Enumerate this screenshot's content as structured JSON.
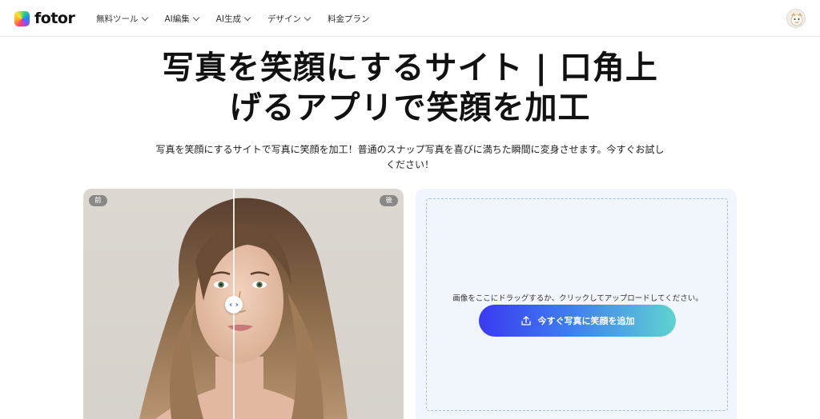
{
  "header": {
    "logo_text": "fotor",
    "nav": [
      {
        "label": "無料ツール",
        "has_dropdown": true
      },
      {
        "label": "AI編集",
        "has_dropdown": true
      },
      {
        "label": "AI生成",
        "has_dropdown": true
      },
      {
        "label": "デザイン",
        "has_dropdown": true
      },
      {
        "label": "料金プラン",
        "has_dropdown": false
      }
    ]
  },
  "hero": {
    "title_line1": "写真を笑顔にするサイト | 口角上",
    "title_line2": "げるアプリで笑顔を加工",
    "subtitle": "写真を笑顔にするサイトで写真に笑顔を加工！普通のスナップ写真を喜びに満ちた瞬間に変身させます。今すぐお試しください！"
  },
  "compare": {
    "before_label": "前",
    "after_label": "後"
  },
  "upload": {
    "hint": "画像をここにドラッグするか、クリックしてアップロードしてください。",
    "button_label": "今すぐ写真に笑顔を追加"
  },
  "colors": {
    "button_gradient_start": "#3a3af0",
    "button_gradient_end": "#5fd3d0",
    "upload_bg": "#f1f6fd"
  }
}
